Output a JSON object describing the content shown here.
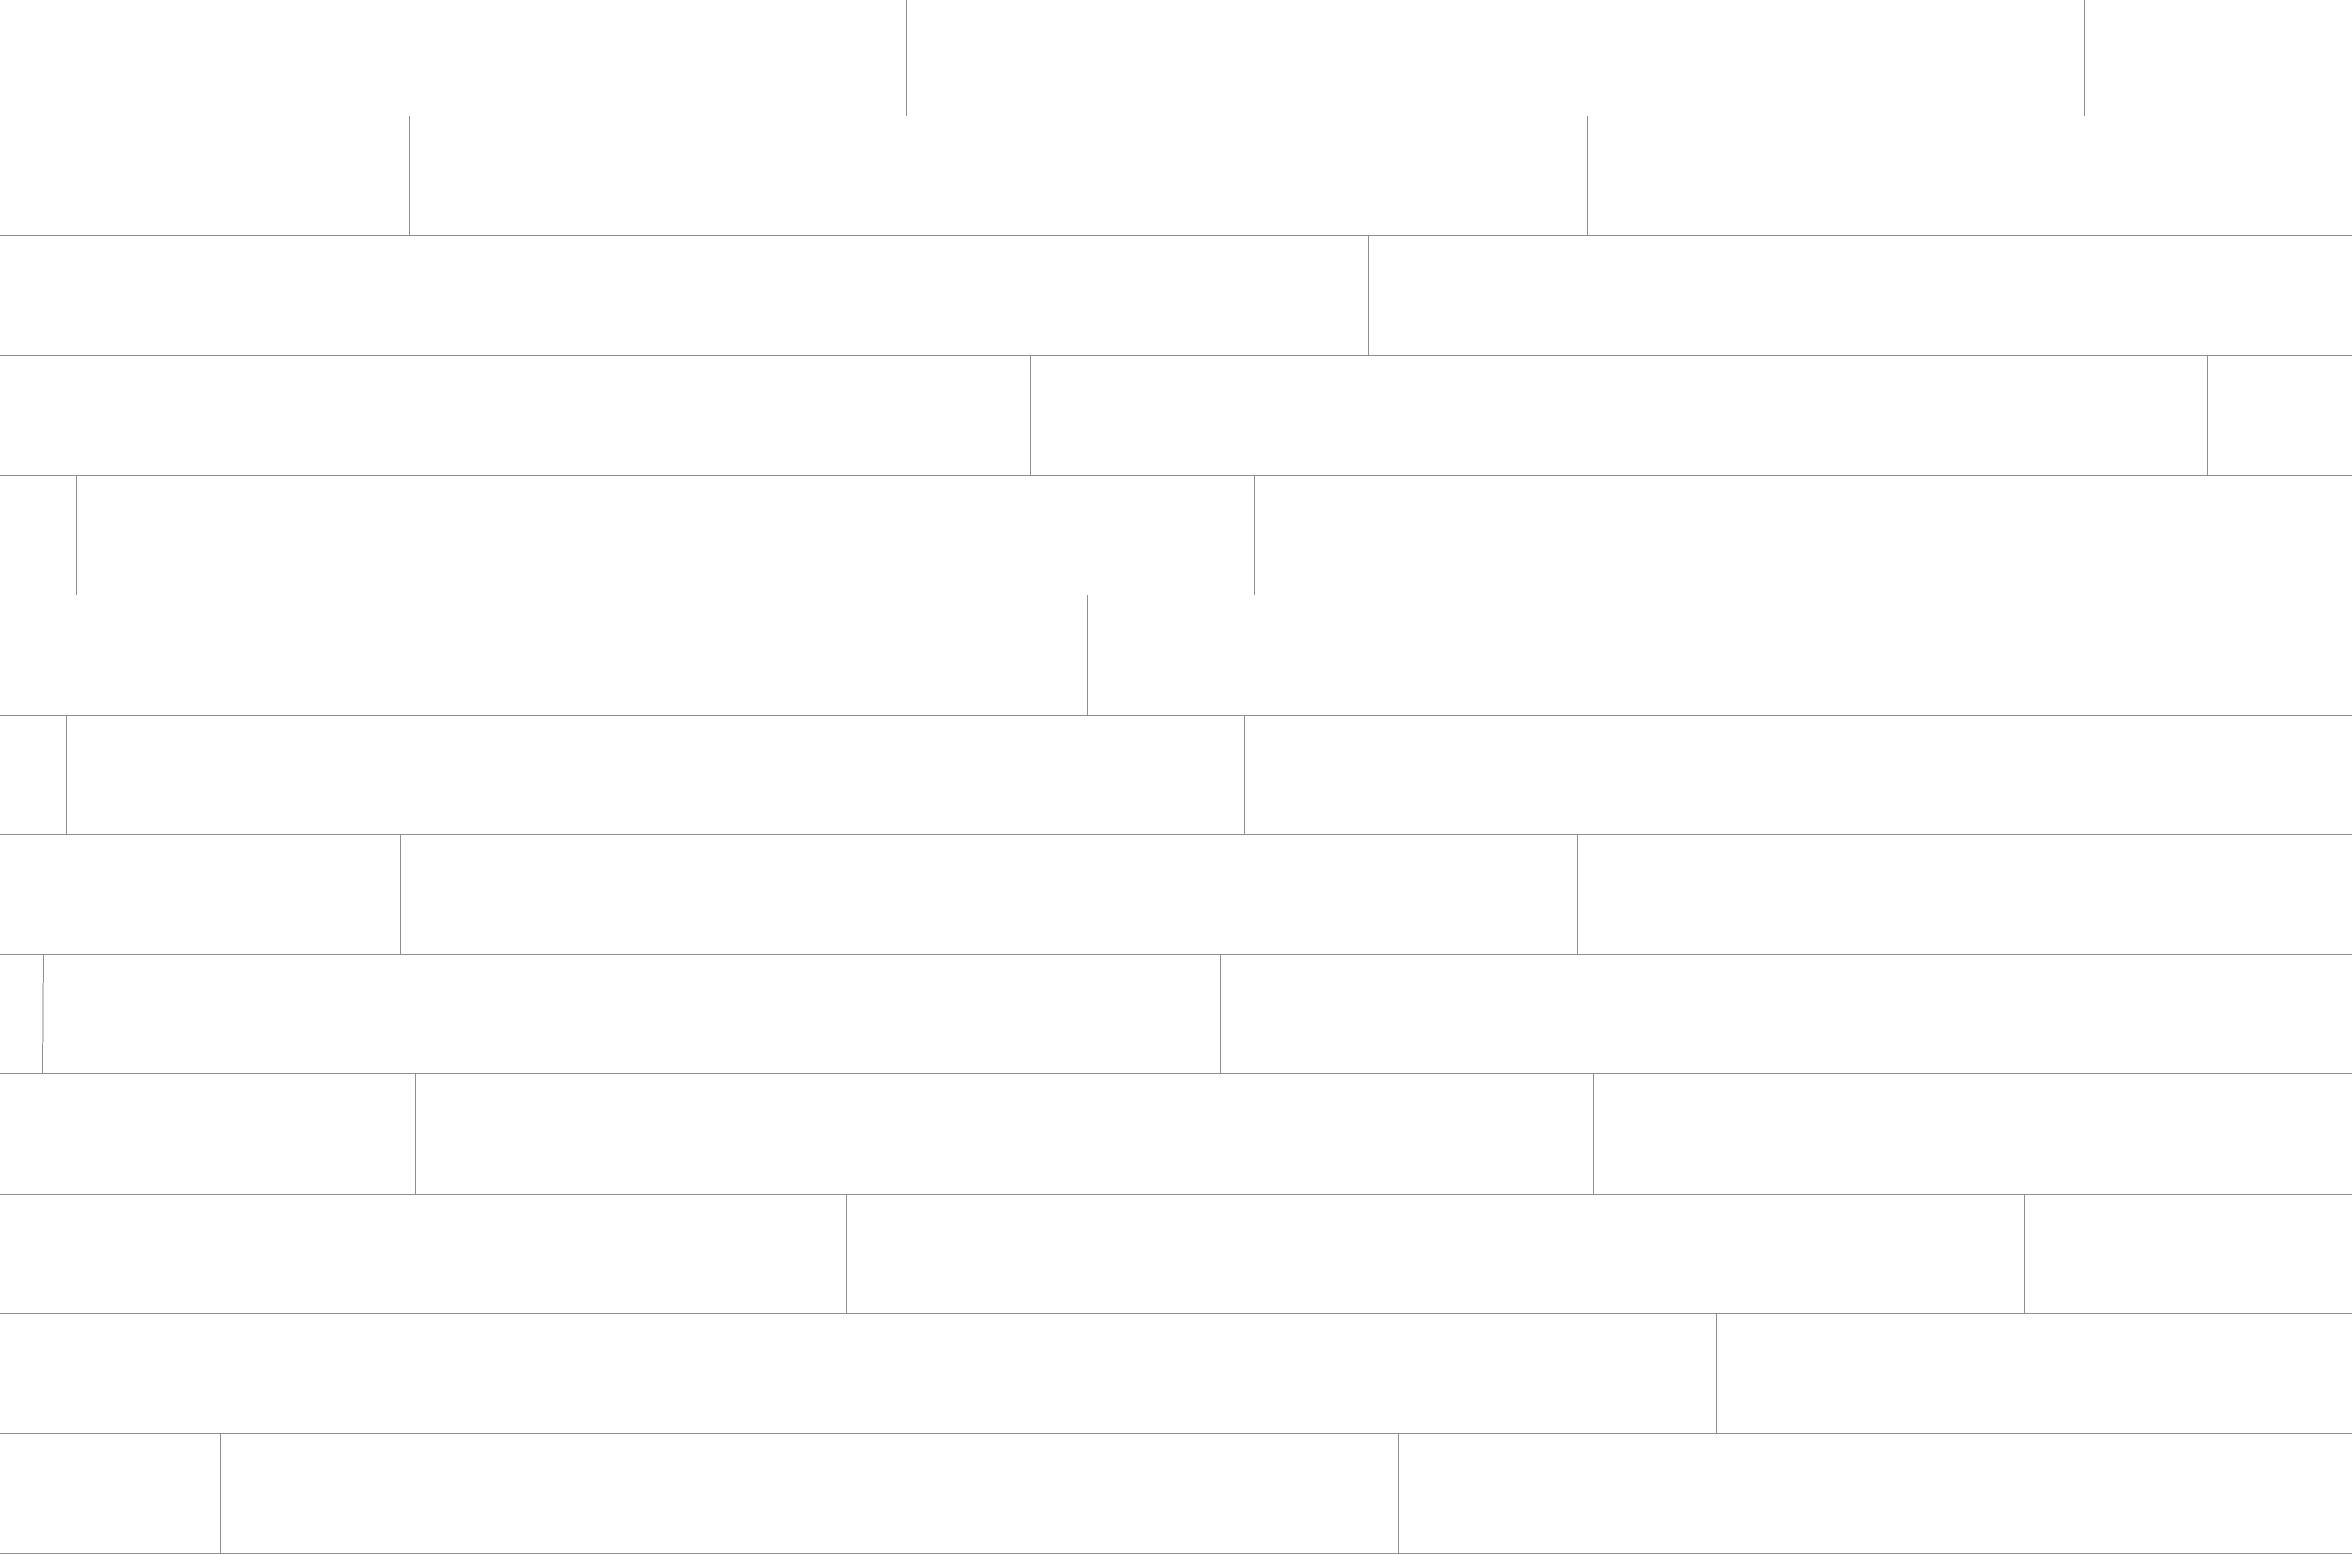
{
  "background_color": "#ffffff",
  "line_color": "#8f8f8f",
  "pattern": {
    "style": "staggered plank rows",
    "row_count": 13,
    "horizontal_seam_count": 12
  }
}
